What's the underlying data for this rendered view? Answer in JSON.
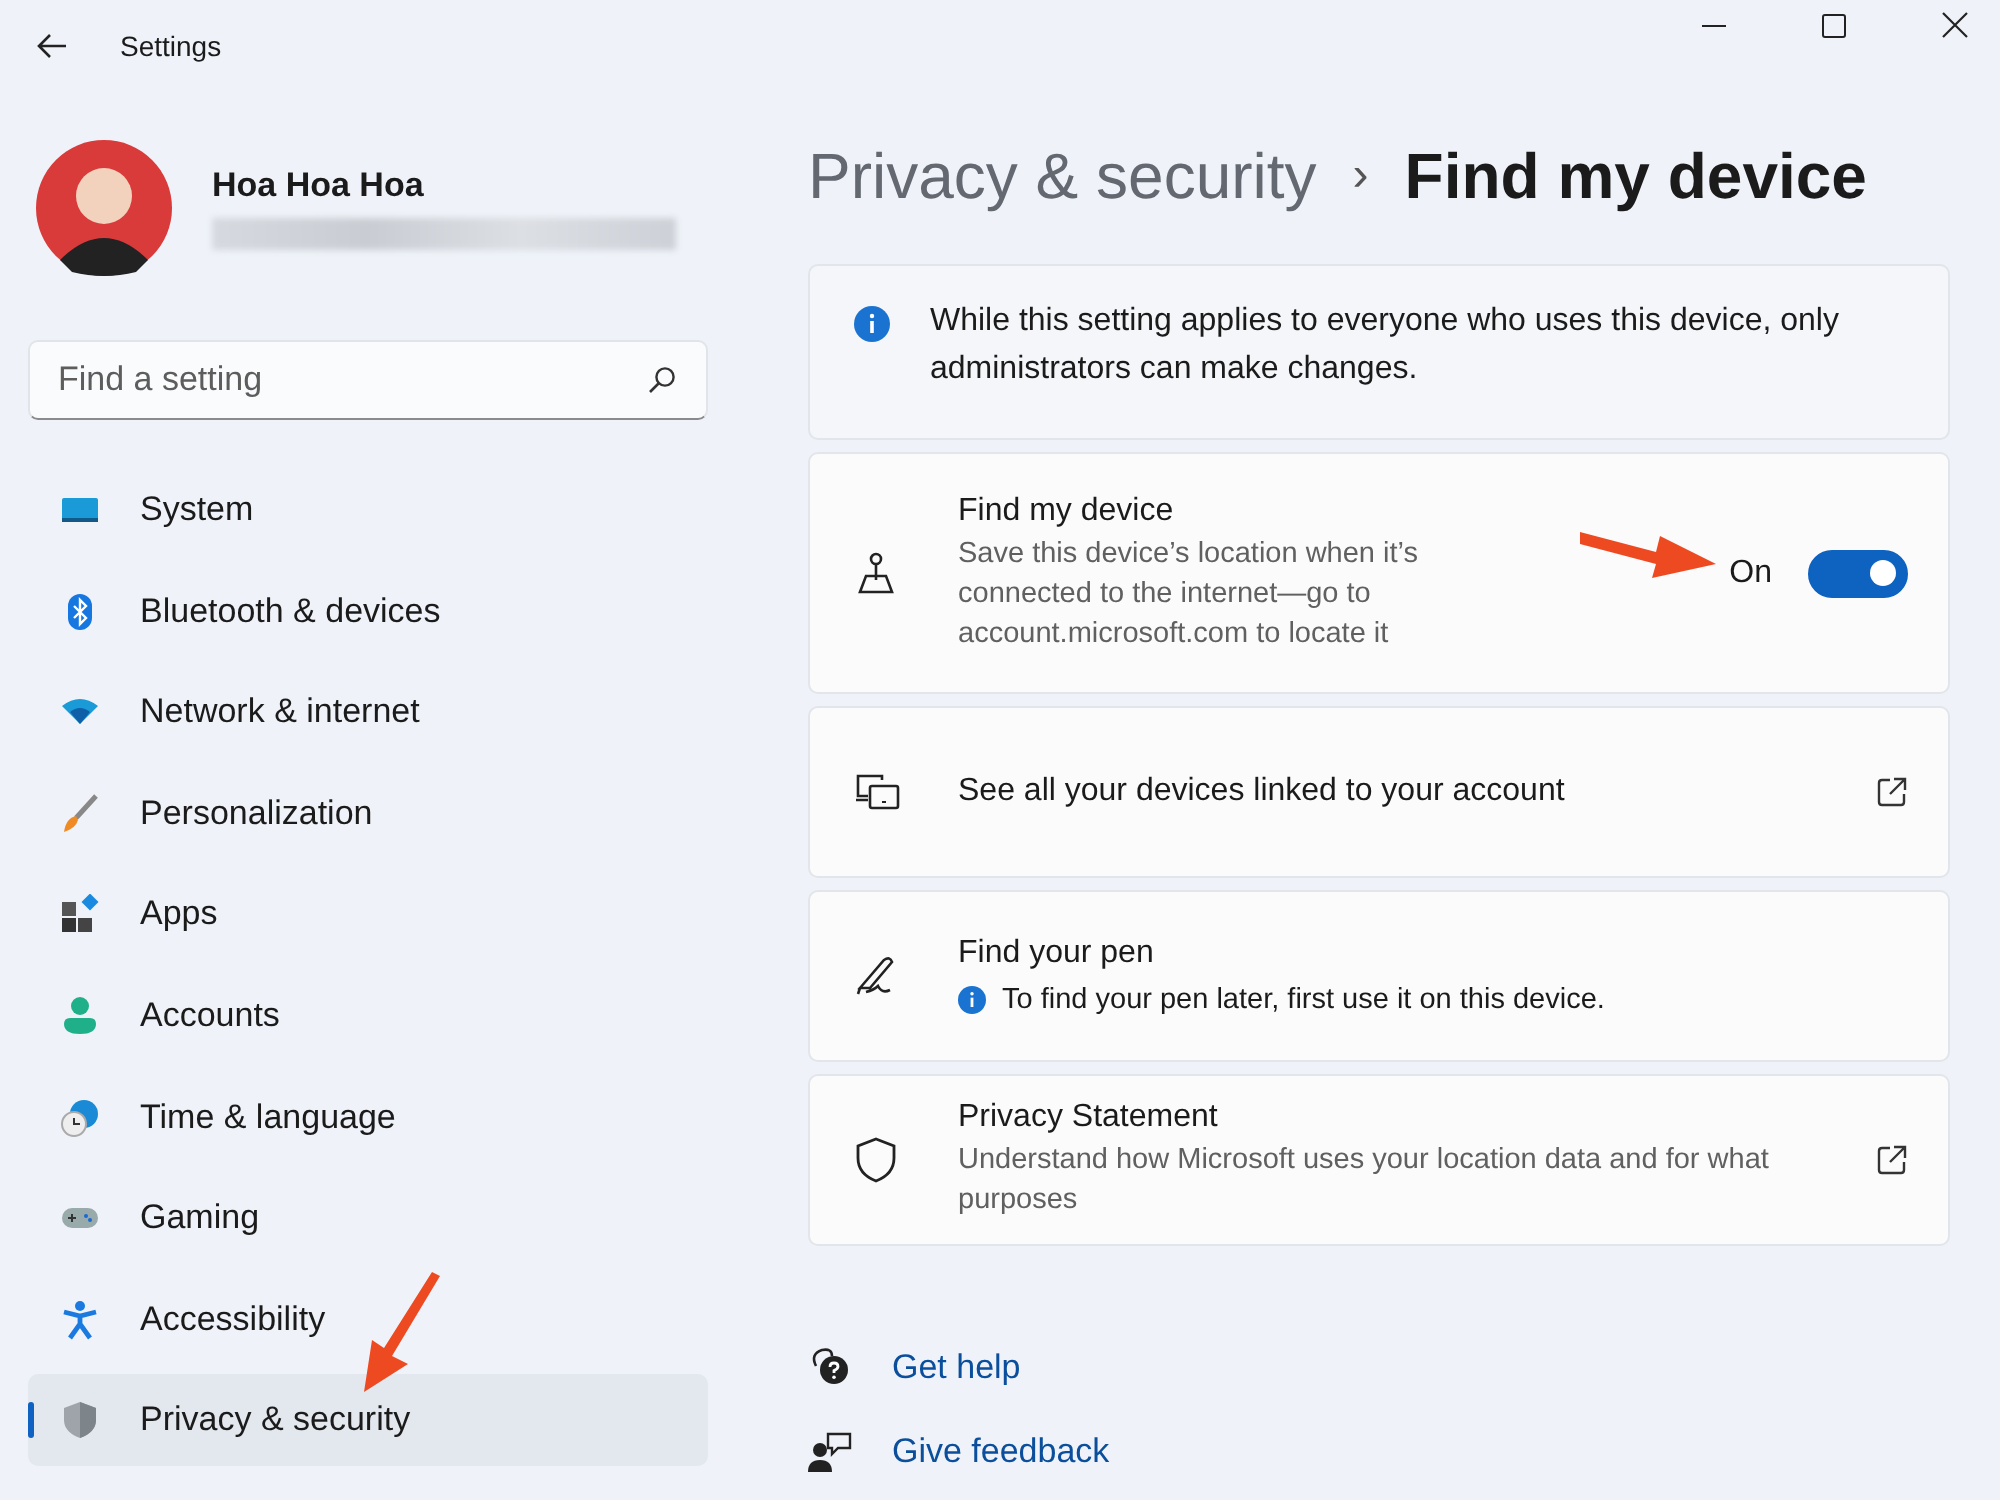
{
  "window": {
    "title": "Settings"
  },
  "user": {
    "name": "Hoa Hoa Hoa"
  },
  "search": {
    "placeholder": "Find a setting"
  },
  "sidebar": {
    "items": [
      {
        "label": "System",
        "selected": false
      },
      {
        "label": "Bluetooth & devices",
        "selected": false
      },
      {
        "label": "Network & internet",
        "selected": false
      },
      {
        "label": "Personalization",
        "selected": false
      },
      {
        "label": "Apps",
        "selected": false
      },
      {
        "label": "Accounts",
        "selected": false
      },
      {
        "label": "Time & language",
        "selected": false
      },
      {
        "label": "Gaming",
        "selected": false
      },
      {
        "label": "Accessibility",
        "selected": false
      },
      {
        "label": "Privacy & security",
        "selected": true
      }
    ]
  },
  "breadcrumb": {
    "parent": "Privacy & security",
    "separator": "›",
    "current": "Find my device"
  },
  "notice": {
    "text": "While this setting applies to everyone who uses this device, only administrators can make changes."
  },
  "cards": [
    {
      "kind": "toggle",
      "title": "Find my device",
      "description": "Save this device’s location when it’s connected to the internet—go to account.microsoft.com to locate it",
      "toggle_label": "On",
      "on": true
    },
    {
      "kind": "link",
      "title": "See all your devices linked to your account"
    },
    {
      "kind": "note",
      "title": "Find your pen",
      "note": "To find your pen later, first use it on this device."
    },
    {
      "kind": "link",
      "title": "Privacy Statement",
      "description": "Understand how Microsoft uses your location data and for what purposes"
    }
  ],
  "help_links": [
    {
      "label": "Get help"
    },
    {
      "label": "Give feedback"
    }
  ]
}
